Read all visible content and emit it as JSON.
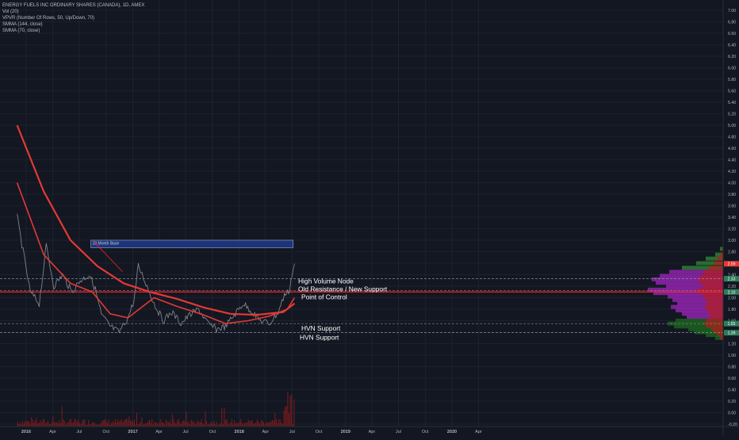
{
  "legend": {
    "symbol_line": "ENERGY FUELS INC ORDINARY SHARES (CANADA), 1D, AMEX",
    "vol_line": "Vol (20)",
    "vpvr_line": "VPVR (Number Of Rows, 50, Up/Down, 70)",
    "smma144_line": "SMMA (144, close)",
    "smma70_line": "SMMA (70, close)"
  },
  "colors": {
    "background": "#131722",
    "grid": "#242a38",
    "axis_text": "#b2b5be",
    "price_line": "#7e8288",
    "smma144": "#e53935",
    "smma70": "#e53935",
    "volume": "#9c1c1c",
    "vpvr_upper": "#2e7d32",
    "vpvr_mid": "#8e24aa",
    "vpvr_support": "#1b5e20",
    "box_fill": "#1e3a8a",
    "box_border": "#7c8db5",
    "horizontal_red": "#ff2222",
    "dashed_white": "#9aa0ab",
    "annotation_text": "#ffffff",
    "last_price_tag": "#e53935"
  },
  "annotations": {
    "box_label": "20 Month Base",
    "high_volume_node": "High Volume Node",
    "old_resistance": "Old Resistance / New Support",
    "point_of_control": "Point of Control",
    "hvn_support_1": "HVN Support",
    "hvn_support_2": "HVN Support"
  },
  "price_tags": {
    "last": "2.59",
    "level_a": "2.33",
    "level_b": "2.10",
    "level_c": "1.55",
    "level_d": "1.39"
  },
  "chart_data": {
    "type": "line",
    "title": "ENERGY FUELS INC ORDINARY SHARES (CANADA), 1D, AMEX",
    "x_ticks": [
      "2016",
      "Apr",
      "Jul",
      "Oct",
      "2017",
      "Apr",
      "Jul",
      "Oct",
      "2018",
      "Apr",
      "Jul",
      "Oct",
      "2019",
      "Apr",
      "Jul",
      "Oct",
      "2020",
      "Apr"
    ],
    "y_ticks": [
      "7.00",
      "6.80",
      "6.60",
      "6.40",
      "6.20",
      "6.00",
      "5.80",
      "5.60",
      "5.40",
      "5.20",
      "5.00",
      "4.80",
      "4.60",
      "4.40",
      "4.20",
      "4.00",
      "3.80",
      "3.60",
      "3.40",
      "3.20",
      "3.00",
      "2.80",
      "2.60",
      "2.40",
      "2.20",
      "2.00",
      "1.80",
      "1.60",
      "1.40",
      "1.20",
      "1.00",
      "0.80",
      "0.60",
      "0.40",
      "0.20",
      "0.00",
      "-0.20"
    ],
    "ylim": [
      -0.2,
      7.0
    ],
    "x_range": [
      "2015-12",
      "2020-06"
    ],
    "grid": true,
    "series": [
      {
        "name": "",
        "dates": [
          "2015-12-01",
          "2016-01-15",
          "2016-02-15",
          "2016-03-10",
          "2016-04-05",
          "2016-05-05",
          "2016-06-05",
          "2016-07-05",
          "2016-08-05",
          "2016-08-25",
          "2016-09-15",
          "2016-10-15",
          "2016-11-15",
          "2016-12-15",
          "2017-01-05",
          "2017-01-20",
          "2017-02-15",
          "2017-03-15",
          "2017-04-15",
          "2017-05-15",
          "2017-06-15",
          "2017-07-15",
          "2017-08-15",
          "2017-09-15",
          "2017-10-15",
          "2017-11-15",
          "2017-12-15",
          "2018-01-15",
          "2018-02-15",
          "2018-03-15",
          "2018-04-15",
          "2018-05-15",
          "2018-06-05",
          "2018-06-20",
          "2018-07-01",
          "2018-07-10"
        ],
        "values": [
          3.4,
          2.1,
          1.9,
          2.9,
          2.2,
          2.4,
          2.1,
          2.3,
          2.4,
          2.15,
          1.7,
          1.5,
          1.4,
          1.65,
          1.95,
          2.55,
          2.25,
          1.9,
          1.6,
          1.75,
          1.55,
          1.7,
          1.8,
          1.55,
          1.45,
          1.5,
          1.7,
          1.9,
          1.75,
          1.6,
          1.55,
          1.75,
          2.05,
          2.1,
          2.4,
          2.59
        ]
      },
      {
        "name": "SMMA (144, close)",
        "dates": [
          "2015-12-01",
          "2016-03-01",
          "2016-06-01",
          "2016-09-01",
          "2016-12-01",
          "2017-03-01",
          "2017-06-01",
          "2017-09-01",
          "2017-12-01",
          "2018-03-01",
          "2018-06-01",
          "2018-07-10"
        ],
        "values": [
          5.0,
          3.85,
          3.0,
          2.55,
          2.25,
          2.1,
          1.98,
          1.83,
          1.72,
          1.7,
          1.75,
          1.9
        ]
      },
      {
        "name": "SMMA (70, close)",
        "dates": [
          "2015-12-01",
          "2016-03-01",
          "2016-06-01",
          "2016-08-15",
          "2016-10-15",
          "2016-12-15",
          "2017-03-15",
          "2017-06-01",
          "2017-09-01",
          "2017-11-15",
          "2018-02-01",
          "2018-04-15",
          "2018-06-15",
          "2018-07-10"
        ],
        "values": [
          4.0,
          2.75,
          2.25,
          2.1,
          1.72,
          1.65,
          2.0,
          1.85,
          1.7,
          1.55,
          1.6,
          1.68,
          1.8,
          2.0
        ]
      }
    ],
    "horizontal_levels": [
      2.33,
      2.1,
      1.55,
      1.39
    ],
    "base_range": [
      2.87,
      3.0
    ]
  }
}
